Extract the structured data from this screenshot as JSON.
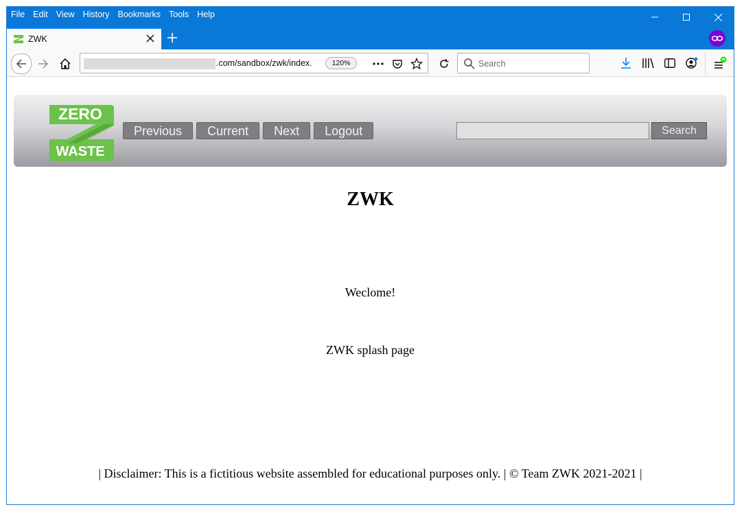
{
  "browser": {
    "menu": [
      "File",
      "Edit",
      "View",
      "History",
      "Bookmarks",
      "Tools",
      "Help"
    ],
    "tab_title": "ZWK",
    "url_visible": ".com/sandbox/zwk/index.",
    "zoom": "120%",
    "search_placeholder": "Search",
    "accent": "#0a78d7"
  },
  "site": {
    "logo_top": "ZERO",
    "logo_bottom": "WASTE",
    "nav": [
      "Previous",
      "Current",
      "Next",
      "Logout"
    ],
    "search_button": "Search",
    "heading": "ZWK",
    "welcome": "Weclome!",
    "splash": "ZWK splash page",
    "footer": "| Disclaimer: This is a fictitious website assembled for educational purposes only. | © Team ZWK 2021-2021 |"
  }
}
